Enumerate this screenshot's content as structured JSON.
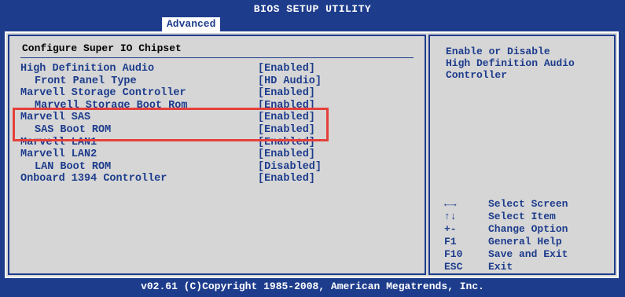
{
  "header": {
    "title": "BIOS SETUP UTILITY",
    "active_tab": "Advanced"
  },
  "section": {
    "title": "Configure Super IO Chipset"
  },
  "items": [
    {
      "label": "High Definition Audio",
      "value": "[Enabled]"
    },
    {
      "label": "Front Panel Type",
      "value": "[HD Audio]"
    },
    {
      "label": "Marvell Storage Controller",
      "value": "[Enabled]"
    },
    {
      "label": "Marvell Storage Boot Rom",
      "value": "[Enabled]"
    },
    {
      "label": "Marvell SAS",
      "value": "[Enabled]"
    },
    {
      "label": "SAS Boot ROM",
      "value": "[Enabled]"
    },
    {
      "label": "Marvell LAN1",
      "value": "[Enabled]"
    },
    {
      "label": "Marvell LAN2",
      "value": "[Enabled]"
    },
    {
      "label": "LAN Boot ROM",
      "value": "[Disabled]"
    },
    {
      "label": "Onboard 1394 Controller",
      "value": "[Enabled]"
    }
  ],
  "help": {
    "text": "Enable or Disable\nHigh Definition Audio\nController"
  },
  "keys": [
    {
      "key": "←→",
      "desc": "Select Screen"
    },
    {
      "key": "↑↓",
      "desc": "Select Item"
    },
    {
      "key": "+-",
      "desc": "Change Option"
    },
    {
      "key": "F1",
      "desc": "General Help"
    },
    {
      "key": "F10",
      "desc": "Save and Exit"
    },
    {
      "key": "ESC",
      "desc": "Exit"
    }
  ],
  "footer": {
    "text": "v02.61 (C)Copyright 1985-2008, American Megatrends, Inc."
  },
  "colors": {
    "background": "#1d3c8c",
    "panel": "#d6d6d6",
    "highlight_box": "#e5403a",
    "text": "#1d3c8c"
  }
}
